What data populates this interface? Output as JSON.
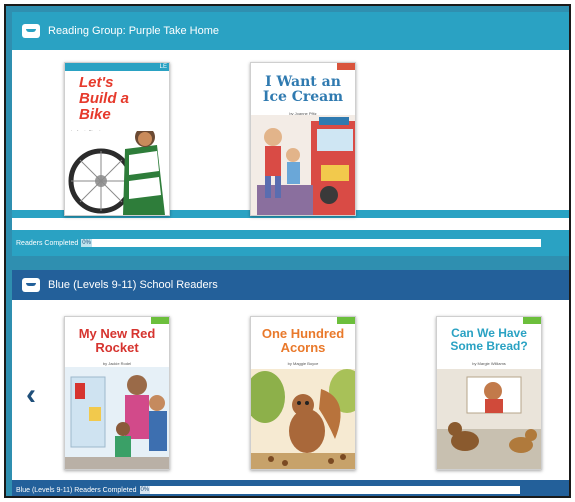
{
  "shelf1": {
    "title": "Reading Group: Purple Take Home",
    "progress_label": "Readers Completed",
    "progress_value": "0%",
    "books": [
      {
        "title": "Let's Build a Bike",
        "author": "by Jessie Ricard",
        "level": "LE"
      },
      {
        "title": "I Want an Ice Cream",
        "author": "by Joanne Pfitz",
        "level": ""
      }
    ]
  },
  "shelf2": {
    "title": "Blue (Levels 9-11) School Readers",
    "progress_label": "Blue (Levels 9-11) Readers Completed",
    "progress_value": "0%",
    "books": [
      {
        "title": "My New Red Rocket",
        "author": "by Jackie Rodel",
        "level": ""
      },
      {
        "title": "One Hundred Acorns",
        "author": "by Maggie Boyce",
        "level": ""
      },
      {
        "title": "Can We Have Some Bread?",
        "author": "by Margie Williams",
        "level": ""
      }
    ]
  },
  "icons": {
    "shelf": "tray-icon",
    "prev": "chevron-left-icon"
  },
  "colors": {
    "shelf1": "#2aa2c3",
    "shelf2": "#23609a",
    "frame": "#2f8fb0"
  }
}
